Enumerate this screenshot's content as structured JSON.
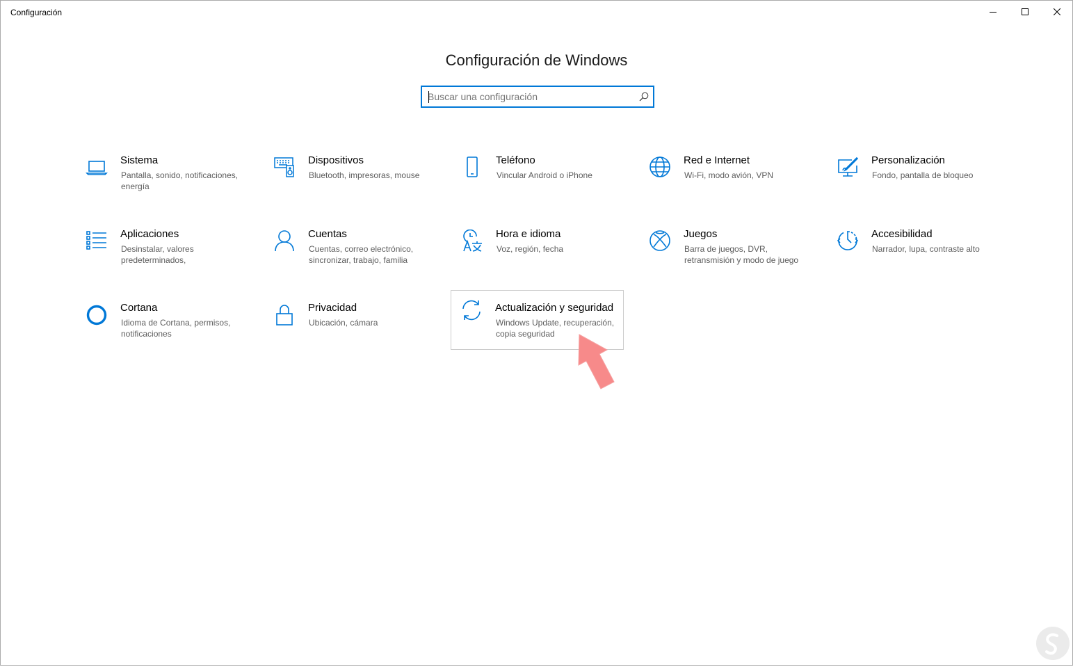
{
  "window": {
    "title": "Configuración"
  },
  "header": {
    "title": "Configuración de Windows",
    "search_placeholder": "Buscar una configuración"
  },
  "accent_color": "#0078d7",
  "categories": [
    {
      "name": "Sistema",
      "description": "Pantalla, sonido, notificaciones, energía",
      "icon": "laptop-icon"
    },
    {
      "name": "Dispositivos",
      "description": "Bluetooth, impresoras, mouse",
      "icon": "devices-icon"
    },
    {
      "name": "Teléfono",
      "description": "Vincular Android o iPhone",
      "icon": "phone-icon"
    },
    {
      "name": "Red e Internet",
      "description": "Wi-Fi, modo avión, VPN",
      "icon": "globe-icon"
    },
    {
      "name": "Personalización",
      "description": "Fondo, pantalla de bloqueo",
      "icon": "paintbrush-icon"
    },
    {
      "name": "Aplicaciones",
      "description": "Desinstalar, valores predeterminados,",
      "icon": "apps-list-icon"
    },
    {
      "name": "Cuentas",
      "description": "Cuentas, correo electrónico, sincronizar, trabajo, familia",
      "icon": "person-icon"
    },
    {
      "name": "Hora e idioma",
      "description": "Voz, región, fecha",
      "icon": "time-language-icon"
    },
    {
      "name": "Juegos",
      "description": "Barra de juegos, DVR, retransmisión y modo de juego",
      "icon": "xbox-icon"
    },
    {
      "name": "Accesibilidad",
      "description": "Narrador, lupa, contraste alto",
      "icon": "ease-of-access-icon"
    },
    {
      "name": "Cortana",
      "description": "Idioma de Cortana, permisos, notificaciones",
      "icon": "cortana-icon"
    },
    {
      "name": "Privacidad",
      "description": "Ubicación, cámara",
      "icon": "lock-icon"
    },
    {
      "name": "Actualización y seguridad",
      "description": "Windows Update, recuperación, copia seguridad",
      "icon": "sync-icon",
      "highlighted": true
    }
  ],
  "annotation": {
    "icon": "pointer-arrow-icon",
    "color": "#f78a8a"
  }
}
